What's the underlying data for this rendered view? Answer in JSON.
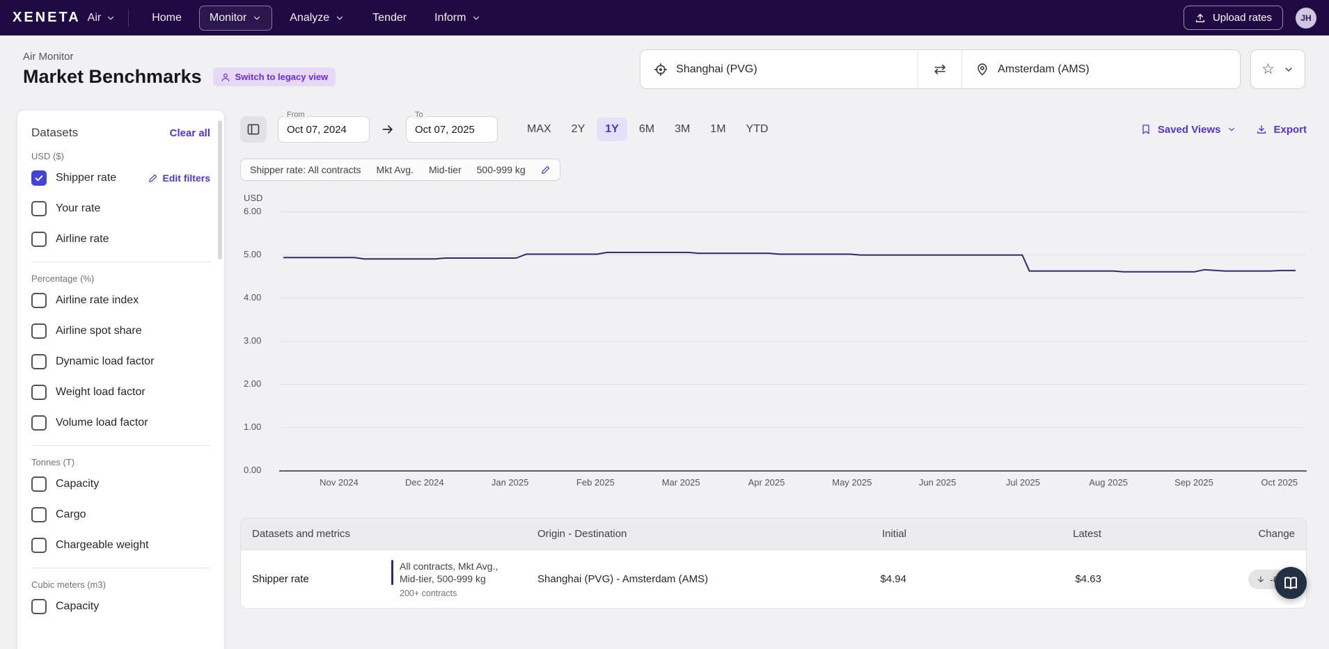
{
  "topnav": {
    "logo": "XENETA",
    "product": "Air",
    "items": [
      {
        "label": "Home",
        "has_dropdown": false,
        "active": false
      },
      {
        "label": "Monitor",
        "has_dropdown": true,
        "active": true
      },
      {
        "label": "Analyze",
        "has_dropdown": true,
        "active": false
      },
      {
        "label": "Tender",
        "has_dropdown": false,
        "active": false
      },
      {
        "label": "Inform",
        "has_dropdown": true,
        "active": false
      }
    ],
    "upload_button": "Upload rates",
    "avatar_initials": "JH"
  },
  "header": {
    "breadcrumb": "Air Monitor",
    "title": "Market Benchmarks",
    "legacy_badge": "Switch to legacy view",
    "origin": "Shanghai (PVG)",
    "destination": "Amsterdam (AMS)"
  },
  "icons": {
    "swap": "⇄",
    "star": "☆"
  },
  "sidebar": {
    "title": "Datasets",
    "clear_all": "Clear all",
    "edit_filters": "Edit filters",
    "groups": [
      {
        "label": "USD ($)",
        "items": [
          {
            "label": "Shipper rate",
            "checked": true,
            "has_edit": true
          },
          {
            "label": "Your rate",
            "checked": false
          },
          {
            "label": "Airline rate",
            "checked": false
          }
        ]
      },
      {
        "label": "Percentage (%)",
        "items": [
          {
            "label": "Airline rate index",
            "checked": false
          },
          {
            "label": "Airline spot share",
            "checked": false
          },
          {
            "label": "Dynamic load factor",
            "checked": false
          },
          {
            "label": "Weight load factor",
            "checked": false
          },
          {
            "label": "Volume load factor",
            "checked": false
          }
        ]
      },
      {
        "label": "Tonnes (T)",
        "items": [
          {
            "label": "Capacity",
            "checked": false
          },
          {
            "label": "Cargo",
            "checked": false
          },
          {
            "label": "Chargeable weight",
            "checked": false
          }
        ]
      },
      {
        "label": "Cubic meters (m3)",
        "items": [
          {
            "label": "Capacity",
            "checked": false
          }
        ]
      }
    ]
  },
  "controls": {
    "from_label": "From",
    "from_value": "Oct 07, 2024",
    "to_label": "To",
    "to_value": "Oct 07, 2025",
    "ranges": [
      "MAX",
      "2Y",
      "1Y",
      "6M",
      "3M",
      "1M",
      "YTD"
    ],
    "selected_range": "1Y",
    "saved_views": "Saved Views",
    "export": "Export"
  },
  "filter_chip": {
    "label": "Shipper rate: All contracts",
    "segments": [
      "Mkt Avg.",
      "Mid-tier",
      "500-999 kg"
    ]
  },
  "chart_data": {
    "type": "line",
    "title": "Shipper rate: All contracts, Mkt Avg., Mid-tier, 500-999 kg",
    "ylabel": "USD",
    "ylim": [
      0,
      6
    ],
    "yticks": [
      "6.00",
      "5.00",
      "4.00",
      "3.00",
      "2.00",
      "1.00",
      "0.00"
    ],
    "xticks": [
      "Nov 2024",
      "Dec 2024",
      "Jan 2025",
      "Feb 2025",
      "Mar 2025",
      "Apr 2025",
      "May 2025",
      "Jun 2025",
      "Jul 2025",
      "Aug 2025",
      "Sep 2025",
      "Oct 2025"
    ],
    "x_range": [
      "Oct 07, 2024",
      "Oct 07, 2025"
    ],
    "grid": true,
    "legend": false,
    "series": [
      {
        "name": "Shipper rate",
        "color": "#2b2a6e",
        "points": [
          [
            0.0,
            4.93
          ],
          [
            0.07,
            4.93
          ],
          [
            0.08,
            4.9
          ],
          [
            0.15,
            4.9
          ],
          [
            0.16,
            4.92
          ],
          [
            0.23,
            4.92
          ],
          [
            0.24,
            5.01
          ],
          [
            0.31,
            5.01
          ],
          [
            0.32,
            5.05
          ],
          [
            0.4,
            5.05
          ],
          [
            0.41,
            5.03
          ],
          [
            0.48,
            5.03
          ],
          [
            0.49,
            5.01
          ],
          [
            0.56,
            5.01
          ],
          [
            0.57,
            4.99
          ],
          [
            0.73,
            4.99
          ],
          [
            0.737,
            4.62
          ],
          [
            0.82,
            4.62
          ],
          [
            0.83,
            4.6
          ],
          [
            0.9,
            4.6
          ],
          [
            0.91,
            4.65
          ],
          [
            0.93,
            4.62
          ],
          [
            0.975,
            4.62
          ],
          [
            0.985,
            4.63
          ],
          [
            1.0,
            4.63
          ]
        ]
      }
    ]
  },
  "table": {
    "headers": [
      "Datasets and metrics",
      "Origin - Destination",
      "Initial",
      "Latest",
      "Change"
    ],
    "rows": [
      {
        "dataset": "Shipper rate",
        "metrics": [
          "All contracts, Mkt Avg.,",
          "Mid-tier, 500-999 kg"
        ],
        "contracts": "200+ contracts",
        "route": "Shanghai (PVG) - Amsterdam (AMS)",
        "initial": "$4.94",
        "latest": "$4.63",
        "change": "-6%"
      }
    ]
  },
  "colors": {
    "nav_bg": "#200a44",
    "accent": "#5233d6",
    "checkbox_checked": "#4442d8",
    "range_selected_text": "#4338ca",
    "range_selected_bg": "#e4e0f9",
    "badge_bg": "#e6d9f7",
    "badge_text": "#6d28d9",
    "line_series": "#2b2a6e",
    "page_bg": "#f1f1f3"
  }
}
